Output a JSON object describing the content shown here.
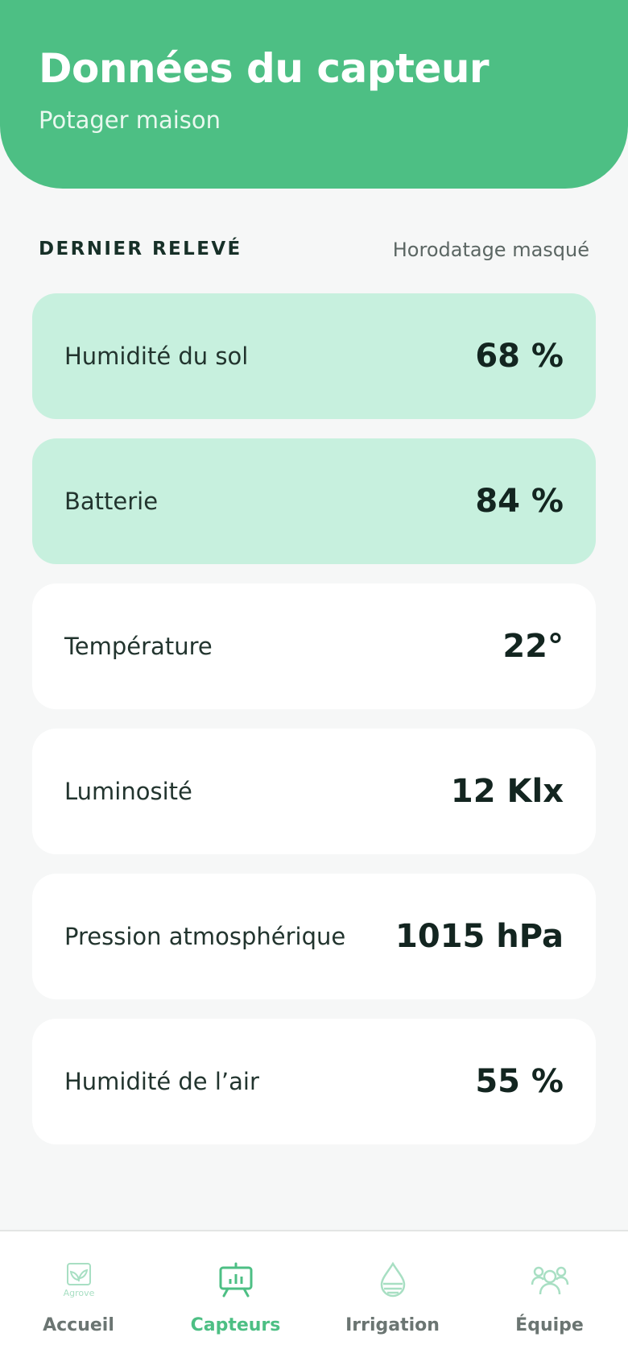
{
  "header": {
    "title": "Données du capteur",
    "subtitle": "Potager maison"
  },
  "section": {
    "label": "DERNIER RELEVÉ",
    "meta": "Horodatage masqué"
  },
  "readings": [
    {
      "label": "Humidité du sol",
      "value": "68 %"
    },
    {
      "label": "Batterie",
      "value": "84 %"
    },
    {
      "label": "Température",
      "value": "22°"
    },
    {
      "label": "Luminosité",
      "value": "12 Klx"
    },
    {
      "label": "Pression atmosphérique",
      "value": "1015 hPa"
    },
    {
      "label": "Humidité de l’air",
      "value": "55 %"
    }
  ],
  "nav": {
    "items": [
      {
        "label": "Accueil",
        "icon": "plant-card-icon",
        "logo_text": "Agrove"
      },
      {
        "label": "Capteurs",
        "icon": "chart-board-icon"
      },
      {
        "label": "Irrigation",
        "icon": "water-drop-icon"
      },
      {
        "label": "Équipe",
        "icon": "team-icon"
      }
    ],
    "active": "Capteurs"
  },
  "colors": {
    "brand": "#4dbf84",
    "highlight_card": "#c7f0de",
    "card": "#ffffff",
    "background": "#f6f7f7",
    "icon_muted": "#a8dfc3"
  }
}
